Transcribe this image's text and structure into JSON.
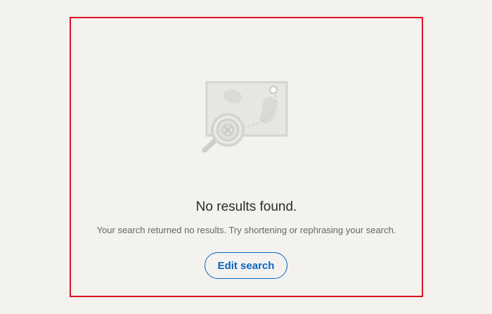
{
  "empty_state": {
    "illustration_icon": "map-search-no-results-icon",
    "title": "No results found.",
    "subtitle": "Your search returned no results. Try shortening or rephrasing your search.",
    "edit_button_label": "Edit search"
  },
  "colors": {
    "background": "#f3f2ef",
    "frame_border": "#d9141c",
    "accent": "#0a66c2",
    "illustration": "#d4d2ce"
  }
}
